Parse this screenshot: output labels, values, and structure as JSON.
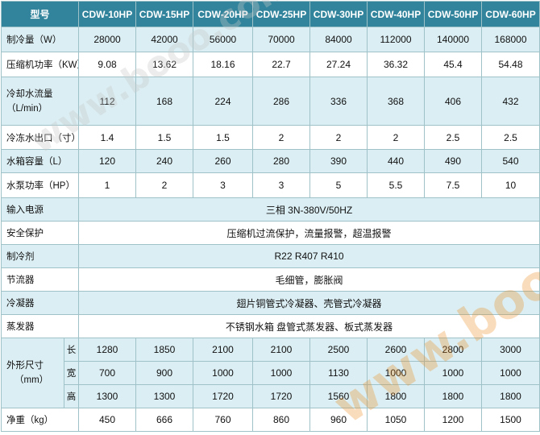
{
  "header": {
    "label": "型号",
    "models": [
      "CDW-10HP",
      "CDW-15HP",
      "CDW-20HP",
      "CDW-25HP",
      "CDW-30HP",
      "CDW-40HP",
      "CDW-50HP",
      "CDW-60HP"
    ]
  },
  "rows": {
    "cooling_capacity": {
      "label": "制冷量（W）",
      "values": [
        "28000",
        "42000",
        "56000",
        "70000",
        "84000",
        "112000",
        "140000",
        "168000"
      ]
    },
    "compressor_power": {
      "label": "压缩机功率（KW）",
      "values": [
        "9.08",
        "13.62",
        "18.16",
        "22.7",
        "27.24",
        "36.32",
        "45.4",
        "54.48"
      ]
    },
    "cooling_water_flow": {
      "label_line1": "冷却水流量",
      "label_line2": "（L/min）",
      "values": [
        "112",
        "168",
        "224",
        "286",
        "336",
        "368",
        "406",
        "432"
      ]
    },
    "chilled_water_outlet": {
      "label": "冷冻水出口（寸）",
      "values": [
        "1.4",
        "1.5",
        "1.5",
        "2",
        "2",
        "2",
        "2.5",
        "2.5"
      ]
    },
    "tank_capacity": {
      "label": "水箱容量（L）",
      "values": [
        "120",
        "240",
        "260",
        "280",
        "390",
        "440",
        "490",
        "540"
      ]
    },
    "pump_power": {
      "label": "水泵功率（HP）",
      "values": [
        "1",
        "2",
        "3",
        "3",
        "5",
        "5.5",
        "7.5",
        "10"
      ]
    },
    "power_supply": {
      "label": "输入电源",
      "value": "三相 3N-380V/50HZ"
    },
    "safety": {
      "label": "安全保护",
      "value": "压缩机过流保护，流量报警，超温报警"
    },
    "refrigerant": {
      "label": "制冷剂",
      "value": "R22 R407 R410"
    },
    "throttle": {
      "label": "节流器",
      "value": "毛细管，膨胀阀"
    },
    "condenser": {
      "label": "冷凝器",
      "value": "翅片铜管式冷凝器、壳管式冷凝器"
    },
    "evaporator": {
      "label": "蒸发器",
      "value": "不锈钢水箱 盘管式蒸发器、板式蒸发器"
    },
    "dimensions": {
      "label_line1": "外形尺寸",
      "label_line2": "（mm）",
      "length_label": "长",
      "length": [
        "1280",
        "1850",
        "2100",
        "2100",
        "2500",
        "2600",
        "2800",
        "3000"
      ],
      "width_label": "宽",
      "width": [
        "700",
        "900",
        "1000",
        "1000",
        "1130",
        "1000",
        "1000",
        "1000"
      ],
      "height_label": "高",
      "height": [
        "1300",
        "1300",
        "1720",
        "1720",
        "1560",
        "1800",
        "1800",
        "1800"
      ]
    },
    "net_weight": {
      "label": "净重（kg）",
      "values": [
        "450",
        "666",
        "760",
        "860",
        "960",
        "1050",
        "1200",
        "1500"
      ]
    }
  },
  "watermarks": [
    "www.booo.com",
    "www.booo.com"
  ]
}
